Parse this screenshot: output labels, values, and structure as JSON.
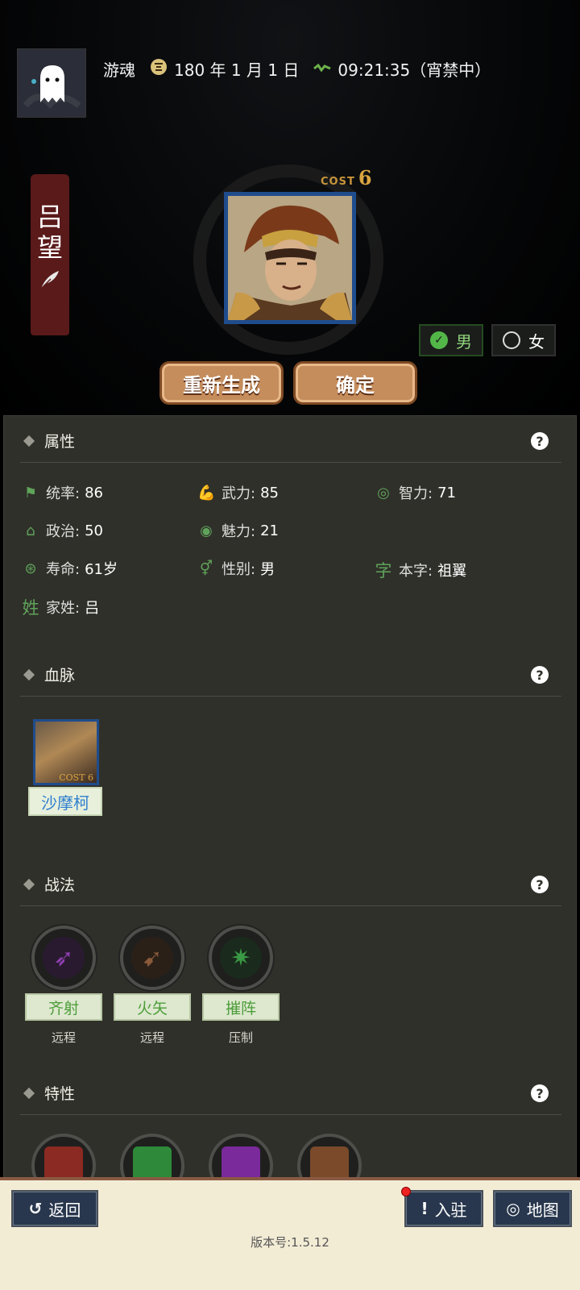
{
  "header": {
    "username": "游魂",
    "date": "180 年 1 月 1 日",
    "time": "09:21:35（宵禁中）"
  },
  "general": {
    "name_chars": [
      "吕",
      "望"
    ],
    "cost_label": "COST",
    "cost_value": "6"
  },
  "gender_options": [
    {
      "label": "男",
      "selected": true
    },
    {
      "label": "女",
      "selected": false
    }
  ],
  "actions": {
    "regenerate": "重新生成",
    "confirm": "确定"
  },
  "sections": {
    "attributes": {
      "title": "属性",
      "items": [
        {
          "icon": "flag-icon",
          "label": "统率:",
          "value": "86"
        },
        {
          "icon": "arm-icon",
          "label": "武力:",
          "value": "85"
        },
        {
          "icon": "brain-icon",
          "label": "智力:",
          "value": "71"
        },
        {
          "icon": "politics-icon",
          "label": "政治:",
          "value": "50"
        },
        {
          "icon": "eye-icon",
          "label": "魅力:",
          "value": "21"
        },
        {
          "icon": "lifespan-icon",
          "label": "寿命:",
          "value": "61岁"
        },
        {
          "icon": "gender-icon",
          "label": "性别:",
          "value": "男"
        },
        {
          "icon": "zi-icon",
          "glyph": "字",
          "label": "本字:",
          "value": "祖翼"
        },
        {
          "icon": "xing-icon",
          "glyph": "姓",
          "label": "家姓:",
          "value": "吕"
        }
      ]
    },
    "bloodline": {
      "title": "血脉",
      "card": {
        "name": "沙摩柯",
        "cost_label": "COST",
        "cost": "6"
      }
    },
    "tactics": {
      "title": "战法",
      "skills": [
        {
          "name": "齐射",
          "type": "远程",
          "icon": "arrows-icon",
          "color": "#8e3fb0"
        },
        {
          "name": "火矢",
          "type": "远程",
          "icon": "fire-arrow-icon",
          "color": "#8a5a3a"
        },
        {
          "name": "摧阵",
          "type": "压制",
          "icon": "crush-icon",
          "color": "#3a9a45"
        }
      ]
    },
    "traits": {
      "title": "特性",
      "items": [
        {
          "icon": "banner-icon",
          "color": "#8a2a22"
        },
        {
          "icon": "soldier-icon",
          "color": "#2e8a3a"
        },
        {
          "icon": "fist-icon",
          "color": "#7a2a9a"
        },
        {
          "icon": "bell-icon",
          "color": "#7a4a2a"
        }
      ]
    }
  },
  "bottom": {
    "back": "返回",
    "station": "入驻",
    "map": "地图",
    "version": "版本号:1.5.12"
  }
}
